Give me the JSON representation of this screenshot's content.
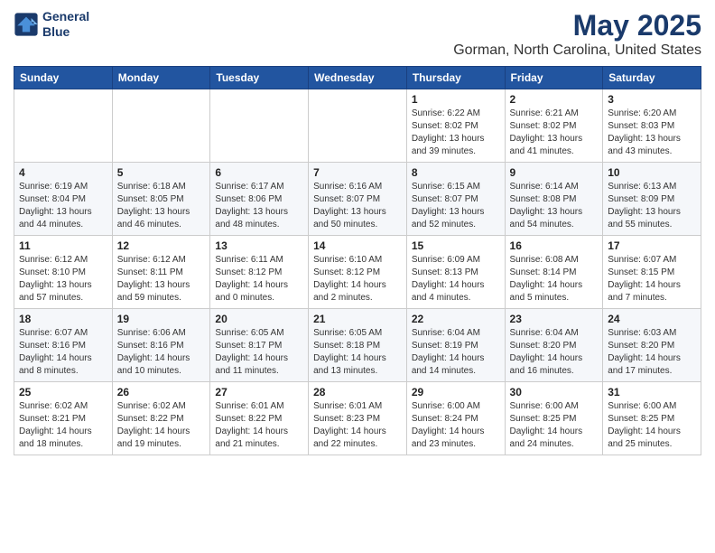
{
  "header": {
    "logo_line1": "General",
    "logo_line2": "Blue",
    "month": "May 2025",
    "location": "Gorman, North Carolina, United States"
  },
  "weekdays": [
    "Sunday",
    "Monday",
    "Tuesday",
    "Wednesday",
    "Thursday",
    "Friday",
    "Saturday"
  ],
  "weeks": [
    [
      {
        "day": "",
        "info": ""
      },
      {
        "day": "",
        "info": ""
      },
      {
        "day": "",
        "info": ""
      },
      {
        "day": "",
        "info": ""
      },
      {
        "day": "1",
        "info": "Sunrise: 6:22 AM\nSunset: 8:02 PM\nDaylight: 13 hours\nand 39 minutes."
      },
      {
        "day": "2",
        "info": "Sunrise: 6:21 AM\nSunset: 8:02 PM\nDaylight: 13 hours\nand 41 minutes."
      },
      {
        "day": "3",
        "info": "Sunrise: 6:20 AM\nSunset: 8:03 PM\nDaylight: 13 hours\nand 43 minutes."
      }
    ],
    [
      {
        "day": "4",
        "info": "Sunrise: 6:19 AM\nSunset: 8:04 PM\nDaylight: 13 hours\nand 44 minutes."
      },
      {
        "day": "5",
        "info": "Sunrise: 6:18 AM\nSunset: 8:05 PM\nDaylight: 13 hours\nand 46 minutes."
      },
      {
        "day": "6",
        "info": "Sunrise: 6:17 AM\nSunset: 8:06 PM\nDaylight: 13 hours\nand 48 minutes."
      },
      {
        "day": "7",
        "info": "Sunrise: 6:16 AM\nSunset: 8:07 PM\nDaylight: 13 hours\nand 50 minutes."
      },
      {
        "day": "8",
        "info": "Sunrise: 6:15 AM\nSunset: 8:07 PM\nDaylight: 13 hours\nand 52 minutes."
      },
      {
        "day": "9",
        "info": "Sunrise: 6:14 AM\nSunset: 8:08 PM\nDaylight: 13 hours\nand 54 minutes."
      },
      {
        "day": "10",
        "info": "Sunrise: 6:13 AM\nSunset: 8:09 PM\nDaylight: 13 hours\nand 55 minutes."
      }
    ],
    [
      {
        "day": "11",
        "info": "Sunrise: 6:12 AM\nSunset: 8:10 PM\nDaylight: 13 hours\nand 57 minutes."
      },
      {
        "day": "12",
        "info": "Sunrise: 6:12 AM\nSunset: 8:11 PM\nDaylight: 13 hours\nand 59 minutes."
      },
      {
        "day": "13",
        "info": "Sunrise: 6:11 AM\nSunset: 8:12 PM\nDaylight: 14 hours\nand 0 minutes."
      },
      {
        "day": "14",
        "info": "Sunrise: 6:10 AM\nSunset: 8:12 PM\nDaylight: 14 hours\nand 2 minutes."
      },
      {
        "day": "15",
        "info": "Sunrise: 6:09 AM\nSunset: 8:13 PM\nDaylight: 14 hours\nand 4 minutes."
      },
      {
        "day": "16",
        "info": "Sunrise: 6:08 AM\nSunset: 8:14 PM\nDaylight: 14 hours\nand 5 minutes."
      },
      {
        "day": "17",
        "info": "Sunrise: 6:07 AM\nSunset: 8:15 PM\nDaylight: 14 hours\nand 7 minutes."
      }
    ],
    [
      {
        "day": "18",
        "info": "Sunrise: 6:07 AM\nSunset: 8:16 PM\nDaylight: 14 hours\nand 8 minutes."
      },
      {
        "day": "19",
        "info": "Sunrise: 6:06 AM\nSunset: 8:16 PM\nDaylight: 14 hours\nand 10 minutes."
      },
      {
        "day": "20",
        "info": "Sunrise: 6:05 AM\nSunset: 8:17 PM\nDaylight: 14 hours\nand 11 minutes."
      },
      {
        "day": "21",
        "info": "Sunrise: 6:05 AM\nSunset: 8:18 PM\nDaylight: 14 hours\nand 13 minutes."
      },
      {
        "day": "22",
        "info": "Sunrise: 6:04 AM\nSunset: 8:19 PM\nDaylight: 14 hours\nand 14 minutes."
      },
      {
        "day": "23",
        "info": "Sunrise: 6:04 AM\nSunset: 8:20 PM\nDaylight: 14 hours\nand 16 minutes."
      },
      {
        "day": "24",
        "info": "Sunrise: 6:03 AM\nSunset: 8:20 PM\nDaylight: 14 hours\nand 17 minutes."
      }
    ],
    [
      {
        "day": "25",
        "info": "Sunrise: 6:02 AM\nSunset: 8:21 PM\nDaylight: 14 hours\nand 18 minutes."
      },
      {
        "day": "26",
        "info": "Sunrise: 6:02 AM\nSunset: 8:22 PM\nDaylight: 14 hours\nand 19 minutes."
      },
      {
        "day": "27",
        "info": "Sunrise: 6:01 AM\nSunset: 8:22 PM\nDaylight: 14 hours\nand 21 minutes."
      },
      {
        "day": "28",
        "info": "Sunrise: 6:01 AM\nSunset: 8:23 PM\nDaylight: 14 hours\nand 22 minutes."
      },
      {
        "day": "29",
        "info": "Sunrise: 6:00 AM\nSunset: 8:24 PM\nDaylight: 14 hours\nand 23 minutes."
      },
      {
        "day": "30",
        "info": "Sunrise: 6:00 AM\nSunset: 8:25 PM\nDaylight: 14 hours\nand 24 minutes."
      },
      {
        "day": "31",
        "info": "Sunrise: 6:00 AM\nSunset: 8:25 PM\nDaylight: 14 hours\nand 25 minutes."
      }
    ]
  ]
}
